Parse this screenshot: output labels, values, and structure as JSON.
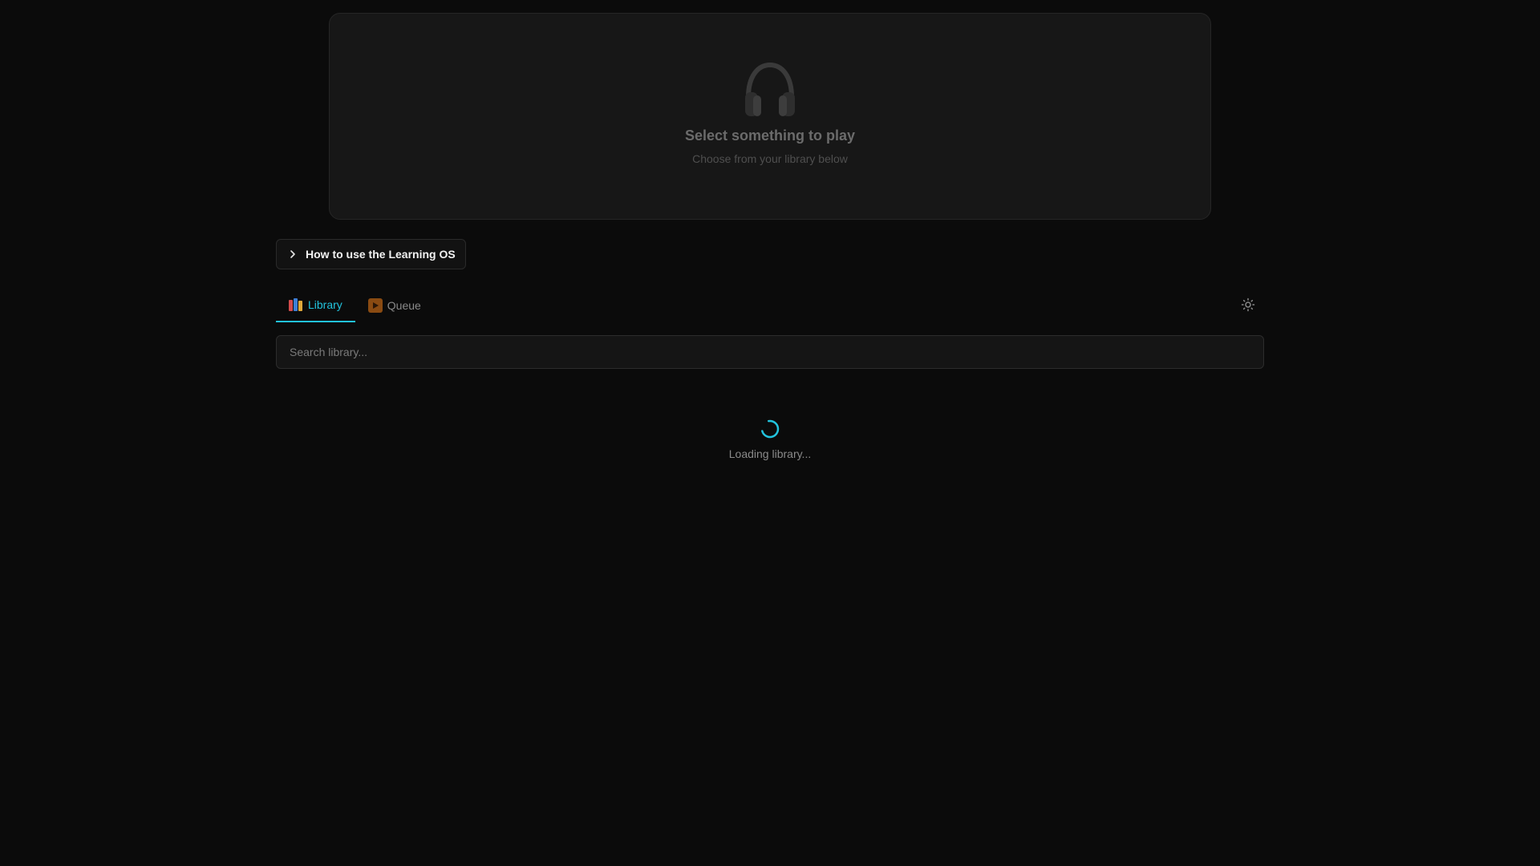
{
  "player": {
    "icon": "headphones-icon",
    "title": "Select something to play",
    "subtitle": "Choose from your library below"
  },
  "howto": {
    "label": "How to use the Learning OS",
    "icon": "chevron-right-icon"
  },
  "tabs": [
    {
      "label": "Library",
      "icon": "books-icon",
      "active": true
    },
    {
      "label": "Queue",
      "icon": "play-button-icon",
      "active": false
    }
  ],
  "settings": {
    "icon": "gear-icon"
  },
  "search": {
    "placeholder": "Search library...",
    "value": ""
  },
  "loading": {
    "text": "Loading library..."
  },
  "colors": {
    "background": "#0b0b0b",
    "accent": "#22c3dd",
    "card": "#171717"
  }
}
